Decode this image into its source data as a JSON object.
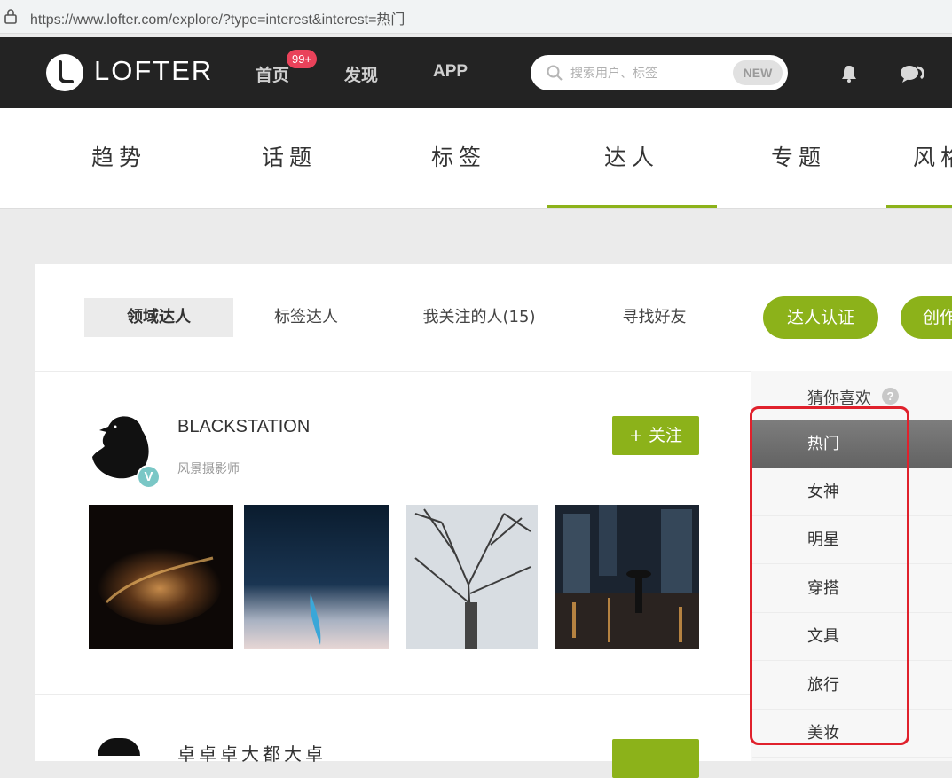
{
  "browser": {
    "url": "https://www.lofter.com/explore/?type=interest&interest=热门"
  },
  "topnav": {
    "logo_text": "LOFTER",
    "links": [
      "首页",
      "发现",
      "APP"
    ],
    "badge": "99+",
    "search_placeholder": "搜索用户、标签",
    "search_new": "NEW",
    "icons": [
      "bell-icon",
      "chat-icon"
    ]
  },
  "categories": [
    "趋势",
    "话题",
    "标签",
    "达人",
    "专题",
    "风格"
  ],
  "active_category": "达人",
  "subtabs": [
    "领域达人",
    "标签达人",
    "我关注的人(15)",
    "寻找好友"
  ],
  "actions": [
    "达人认证",
    "创作"
  ],
  "users": [
    {
      "name": "BLACKSTATION",
      "title": "风景摄影师",
      "follow_label": "+ 关注",
      "verified": "V"
    },
    {
      "name": "卓卓卓大都大卓"
    }
  ],
  "sidebar": {
    "heading": "猜你喜欢",
    "help": "?",
    "items": [
      "热门",
      "女神",
      "明星",
      "穿搭",
      "文具",
      "旅行",
      "美妆"
    ],
    "active": "热门"
  },
  "colors": {
    "accent": "#8cb21a",
    "badge": "#e9425a",
    "highlight": "#e0212c",
    "topbar": "#232323"
  }
}
